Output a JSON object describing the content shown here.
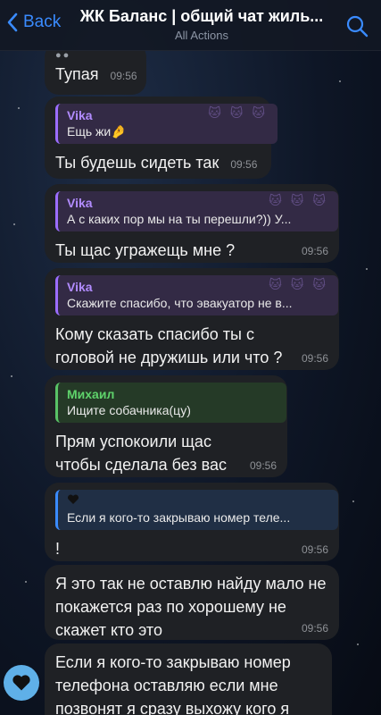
{
  "header": {
    "back_label": "Back",
    "title": "ЖК Баланс | общий чат жиль...",
    "subtitle": "All Actions"
  },
  "messages": [
    {
      "text": "Тупая",
      "time": "09:56"
    },
    {
      "reply_author": "Vika",
      "reply_text": "Ещь жи🤌",
      "text": "Ты будешь сидеть так",
      "time": "09:56"
    },
    {
      "reply_author": "Vika",
      "reply_text": "А с каких пор мы на ты перешли?)) У...",
      "text": "Ты щас угражещь мне ?",
      "time": "09:56"
    },
    {
      "reply_author": "Vika",
      "reply_text": "Скажите спасибо, что эвакуатор не в...",
      "text": "Кому сказать спасибо ты с головой не дружишь или что ?",
      "time": "09:56"
    },
    {
      "reply_author": "Михаил",
      "reply_text": "Ищите собачника(цу)",
      "text": "Прям успокоили щас чтобы сделала без вас",
      "time": "09:56"
    },
    {
      "reply_text": "Если я кого-то закрываю номер теле...",
      "text": "!",
      "time": "09:56"
    },
    {
      "text": "Я это так не оставлю найду мало не покажется раз по хорошему не скажет кто это",
      "time": "09:56"
    },
    {
      "text": "Если я кого-то закрываю номер телефона оставляю если мне позвонят я сразу выхожу кого я"
    }
  ],
  "colors": {
    "accent": "#3a8bff",
    "bubble": "#1f2125",
    "vika": "#b28cff",
    "mikhail": "#5fd36b"
  }
}
